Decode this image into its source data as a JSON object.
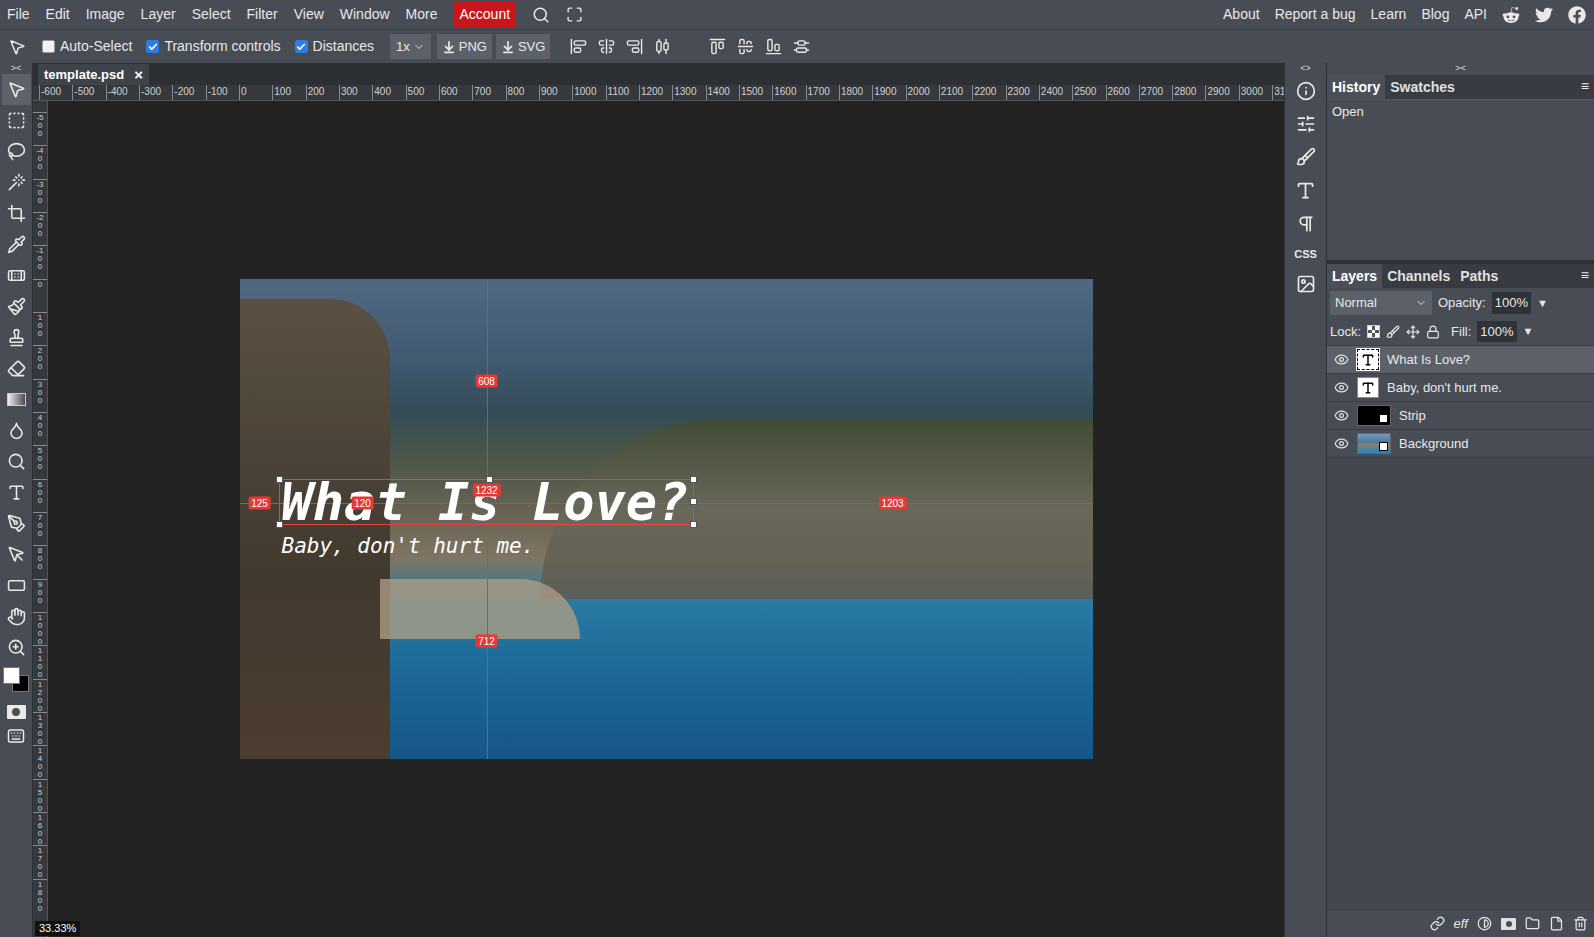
{
  "menu_bar": {
    "items": [
      "File",
      "Edit",
      "Image",
      "Layer",
      "Select",
      "Filter",
      "View",
      "Window",
      "More"
    ],
    "account": {
      "label": "Account",
      "highlighted": true
    },
    "links": [
      "About",
      "Report a bug",
      "Learn",
      "Blog",
      "API"
    ]
  },
  "options_bar": {
    "checkboxes": [
      {
        "label": "Auto-Select",
        "checked": false
      },
      {
        "label": "Transform controls",
        "checked": true
      },
      {
        "label": "Distances",
        "checked": true
      }
    ],
    "scale": "1x",
    "export_buttons": [
      "PNG",
      "SVG"
    ]
  },
  "panel_toggles": {
    "left": "><",
    "middle": "<>",
    "right": "><"
  },
  "tools": [
    {
      "selected": true
    },
    {
      "selected": false
    },
    {
      "selected": false
    },
    {
      "selected": false
    },
    {
      "selected": false
    },
    {
      "selected": false
    },
    {
      "selected": false
    },
    {
      "selected": false
    },
    {
      "selected": false
    },
    {
      "selected": false
    },
    {
      "selected": false
    },
    {
      "selected": false
    },
    {
      "selected": false
    },
    {
      "selected": false
    },
    {
      "selected": false
    },
    {
      "selected": false
    },
    {
      "selected": false
    },
    {
      "selected": false
    },
    {
      "selected": false
    }
  ],
  "colors": {
    "foreground": "#ffffff",
    "background": "#000000"
  },
  "document_tabs": [
    {
      "title": "template.psd",
      "close": "×",
      "selected": true
    }
  ],
  "rulers": {
    "horizontal": [
      "-600",
      "-500",
      "-400",
      "-300",
      "-200",
      "-100",
      "0",
      "100",
      "200",
      "300",
      "400",
      "500",
      "600",
      "700",
      "800",
      "900",
      "1000",
      "1100",
      "1200",
      "1300",
      "1400",
      "1500",
      "1600",
      "1700",
      "1800",
      "1900",
      "2000",
      "2100",
      "2200",
      "2300",
      "2400",
      "2500",
      "2600",
      "2700",
      "2800",
      "2900",
      "3000",
      "31"
    ],
    "vertical": [
      "-500",
      "-400",
      "-300",
      "-200",
      "-100",
      "0",
      "100",
      "200",
      "300",
      "400",
      "500",
      "600",
      "700",
      "800",
      "900",
      "1000",
      "1100",
      "1200",
      "1300",
      "1400",
      "1500",
      "1600",
      "1700",
      "1800"
    ]
  },
  "canvas": {
    "title": "What Is Love?",
    "subtitle": "Baby, don't hurt me.",
    "distances": [
      {
        "label": "608"
      },
      {
        "label": "1232"
      },
      {
        "label": "125"
      },
      {
        "label": "120"
      },
      {
        "label": "1203"
      },
      {
        "label": "712"
      }
    ]
  },
  "zoom": "33.33%",
  "side_icons": {
    "css_label": "CSS"
  },
  "history_panel": {
    "tabs": [
      {
        "label": "History",
        "selected": true
      },
      {
        "label": "Swatches",
        "selected": false
      }
    ],
    "menu": "≡",
    "items": [
      {
        "label": "Open",
        "selected": false
      }
    ]
  },
  "layers_panel": {
    "tabs": [
      {
        "label": "Layers",
        "selected": true
      },
      {
        "label": "Channels",
        "selected": false
      },
      {
        "label": "Paths",
        "selected": false
      }
    ],
    "menu": "≡",
    "blend_mode": "Normal",
    "opacity_label": "Opacity:",
    "opacity": "100%",
    "opacity_arrow": "▼",
    "lock_label": "Lock:",
    "fill_label": "Fill:",
    "fill": "100%",
    "fill_arrow": "▼",
    "effects_label": "eff",
    "layers": [
      {
        "name": "What Is Love?",
        "kind": "text",
        "visible": true,
        "selected": true
      },
      {
        "name": "Baby, don't hurt me.",
        "kind": "text",
        "visible": true,
        "selected": false
      },
      {
        "name": "Strip",
        "kind": "smart",
        "visible": true,
        "selected": false
      },
      {
        "name": "Background",
        "kind": "image",
        "visible": true,
        "selected": false
      }
    ]
  }
}
